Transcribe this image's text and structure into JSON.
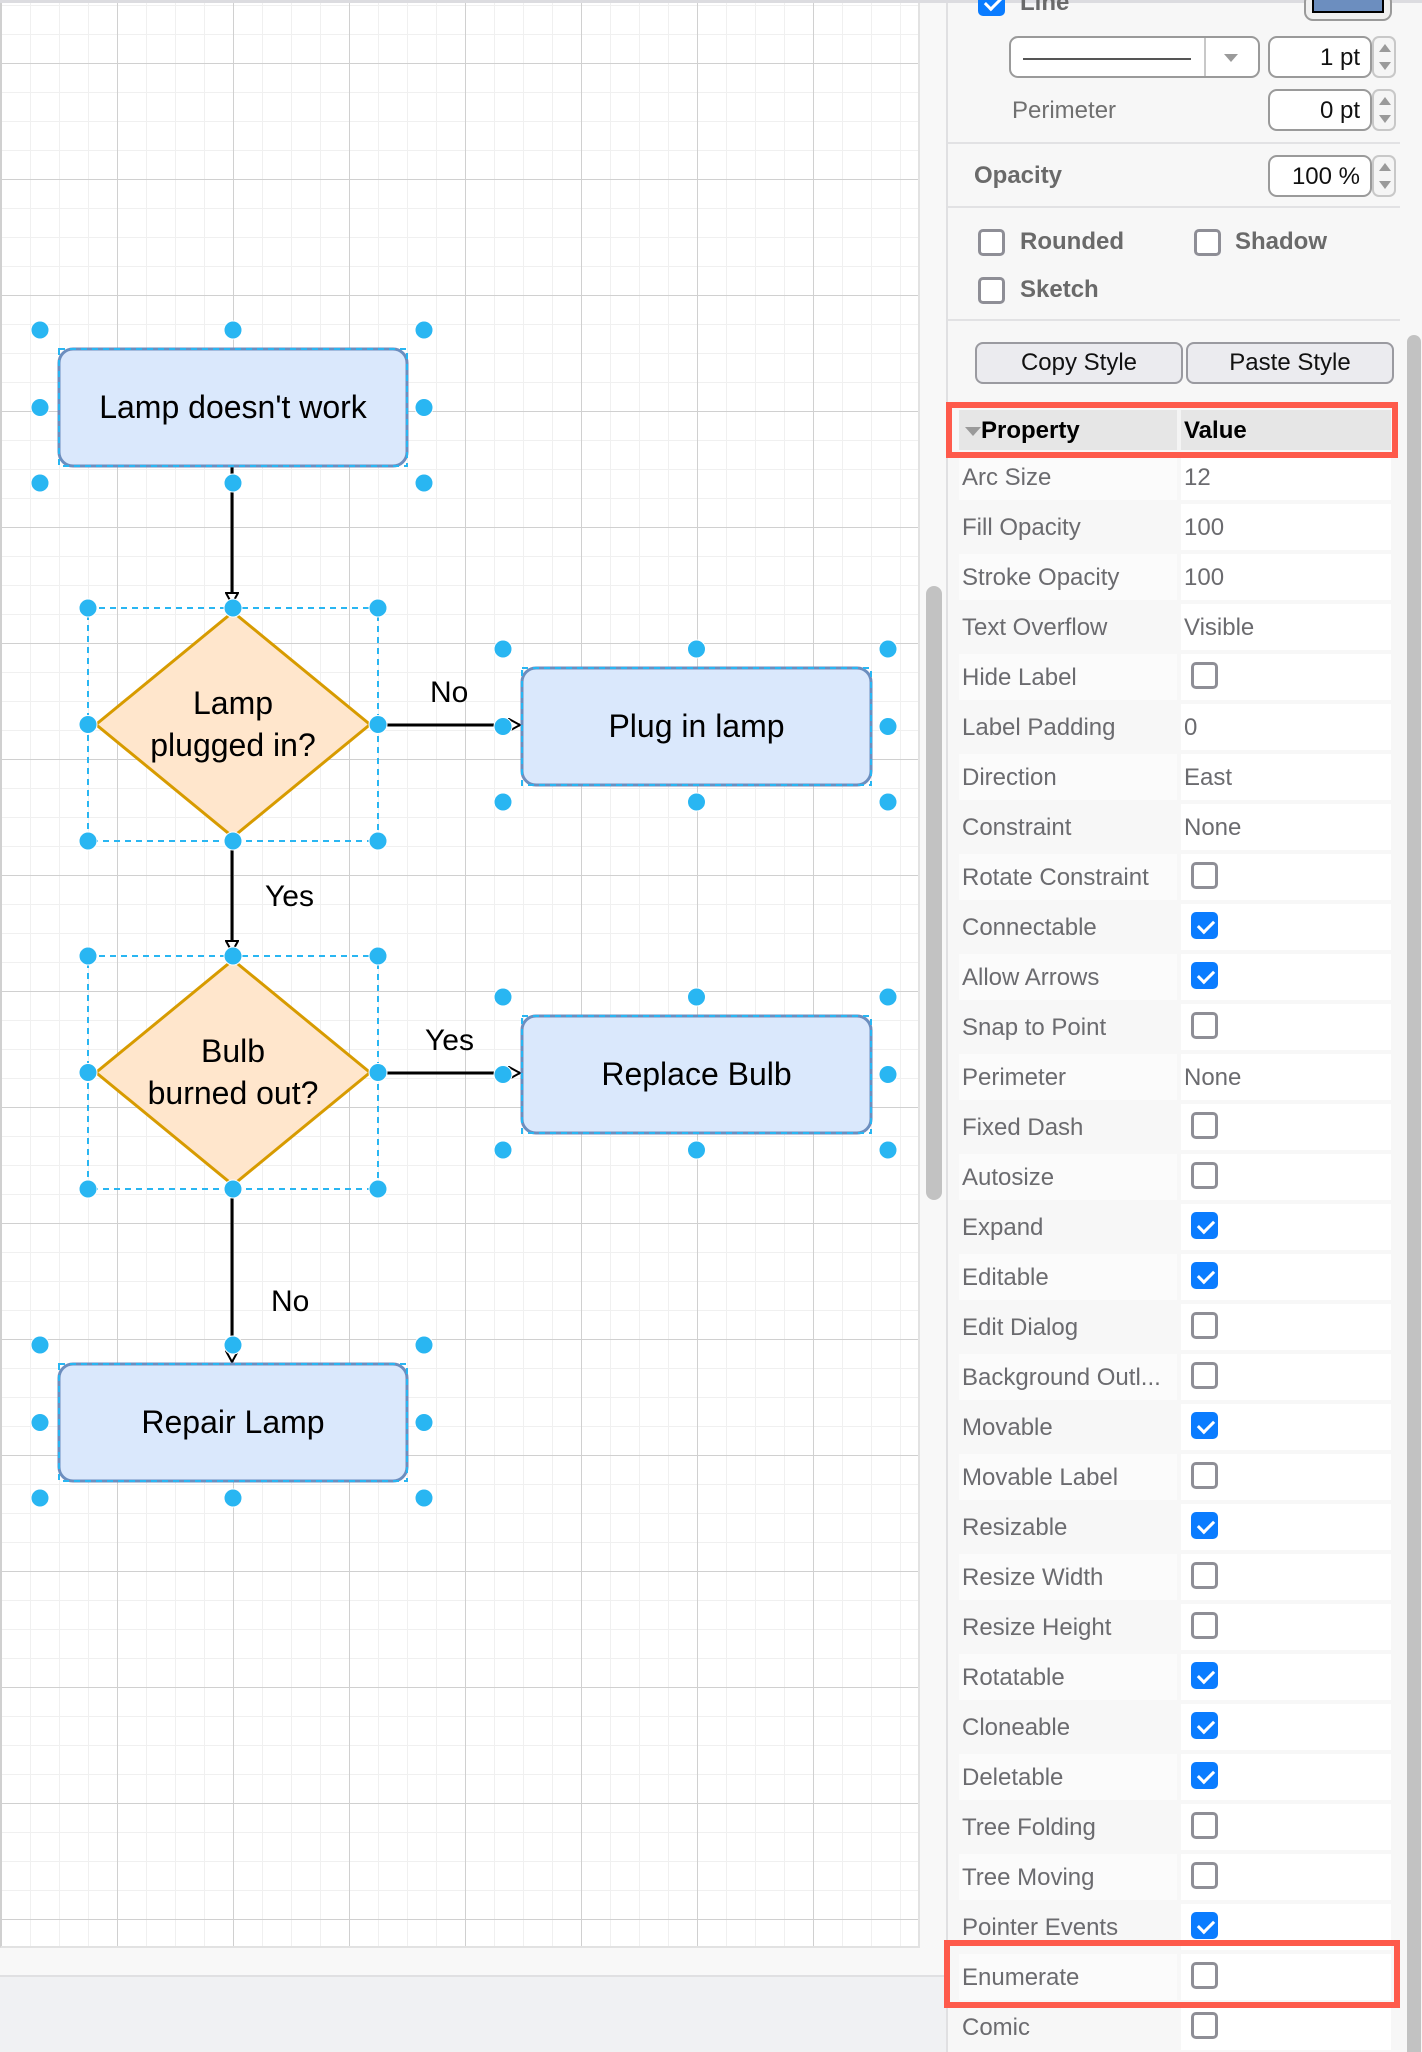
{
  "diagram": {
    "nodes": [
      {
        "id": "lamp-doesnt-work",
        "label": "Lamp doesn't work",
        "shape": "rounded-rect"
      },
      {
        "id": "lamp-plugged-in",
        "label": "Lamp\nplugged in?",
        "shape": "diamond"
      },
      {
        "id": "plug-in-lamp",
        "label": "Plug in lamp",
        "shape": "rounded-rect"
      },
      {
        "id": "bulb-burned-out",
        "label": "Bulb\nburned out?",
        "shape": "diamond"
      },
      {
        "id": "replace-bulb",
        "label": "Replace Bulb",
        "shape": "rounded-rect"
      },
      {
        "id": "repair-lamp",
        "label": "Repair Lamp",
        "shape": "rounded-rect"
      }
    ],
    "edges": [
      {
        "from": "lamp-doesnt-work",
        "to": "lamp-plugged-in",
        "label": ""
      },
      {
        "from": "lamp-plugged-in",
        "to": "plug-in-lamp",
        "label": "No"
      },
      {
        "from": "lamp-plugged-in",
        "to": "bulb-burned-out",
        "label": "Yes"
      },
      {
        "from": "bulb-burned-out",
        "to": "replace-bulb",
        "label": "Yes"
      },
      {
        "from": "bulb-burned-out",
        "to": "repair-lamp",
        "label": "No"
      }
    ],
    "colors": {
      "process_fill": "#dae8fc",
      "process_stroke": "#6c8ebf",
      "decision_fill": "#ffe6cc",
      "decision_stroke": "#d79b00",
      "selection_handle": "#29b6f2"
    }
  },
  "panel": {
    "line": {
      "label": "Line",
      "checked": true,
      "color": "#6c8ebf",
      "width_value": "1 pt"
    },
    "perimeter": {
      "label": "Perimeter",
      "value": "0 pt"
    },
    "opacity": {
      "label": "Opacity",
      "value": "100 %"
    },
    "options": [
      {
        "label": "Rounded",
        "checked": false
      },
      {
        "label": "Shadow",
        "checked": false
      },
      {
        "label": "Sketch",
        "checked": false
      }
    ],
    "copy_style_label": "Copy Style",
    "paste_style_label": "Paste Style",
    "table": {
      "header_property": "Property",
      "header_value": "Value",
      "rows": [
        {
          "name": "Arc Size",
          "value": "12"
        },
        {
          "name": "Fill Opacity",
          "value": "100"
        },
        {
          "name": "Stroke Opacity",
          "value": "100"
        },
        {
          "name": "Text Overflow",
          "value": "Visible"
        },
        {
          "name": "Hide Label",
          "checked": false
        },
        {
          "name": "Label Padding",
          "value": "0"
        },
        {
          "name": "Direction",
          "value": "East"
        },
        {
          "name": "Constraint",
          "value": "None"
        },
        {
          "name": "Rotate Constraint",
          "checked": false
        },
        {
          "name": "Connectable",
          "checked": true
        },
        {
          "name": "Allow Arrows",
          "checked": true
        },
        {
          "name": "Snap to Point",
          "checked": false
        },
        {
          "name": "Perimeter",
          "value": "None"
        },
        {
          "name": "Fixed Dash",
          "checked": false
        },
        {
          "name": "Autosize",
          "checked": false
        },
        {
          "name": "Expand",
          "checked": true
        },
        {
          "name": "Editable",
          "checked": true
        },
        {
          "name": "Edit Dialog",
          "checked": false
        },
        {
          "name": "Background Outl...",
          "checked": false
        },
        {
          "name": "Movable",
          "checked": true
        },
        {
          "name": "Movable Label",
          "checked": false
        },
        {
          "name": "Resizable",
          "checked": true
        },
        {
          "name": "Resize Width",
          "checked": false
        },
        {
          "name": "Resize Height",
          "checked": false
        },
        {
          "name": "Rotatable",
          "checked": true
        },
        {
          "name": "Cloneable",
          "checked": true
        },
        {
          "name": "Deletable",
          "checked": true
        },
        {
          "name": "Tree Folding",
          "checked": false
        },
        {
          "name": "Tree Moving",
          "checked": false
        },
        {
          "name": "Pointer Events",
          "checked": true
        },
        {
          "name": "Enumerate",
          "checked": false
        },
        {
          "name": "Comic",
          "checked": false
        }
      ]
    },
    "highlight_color": "#fe5a4b",
    "checkbox_on_color": "#0a7cff"
  }
}
